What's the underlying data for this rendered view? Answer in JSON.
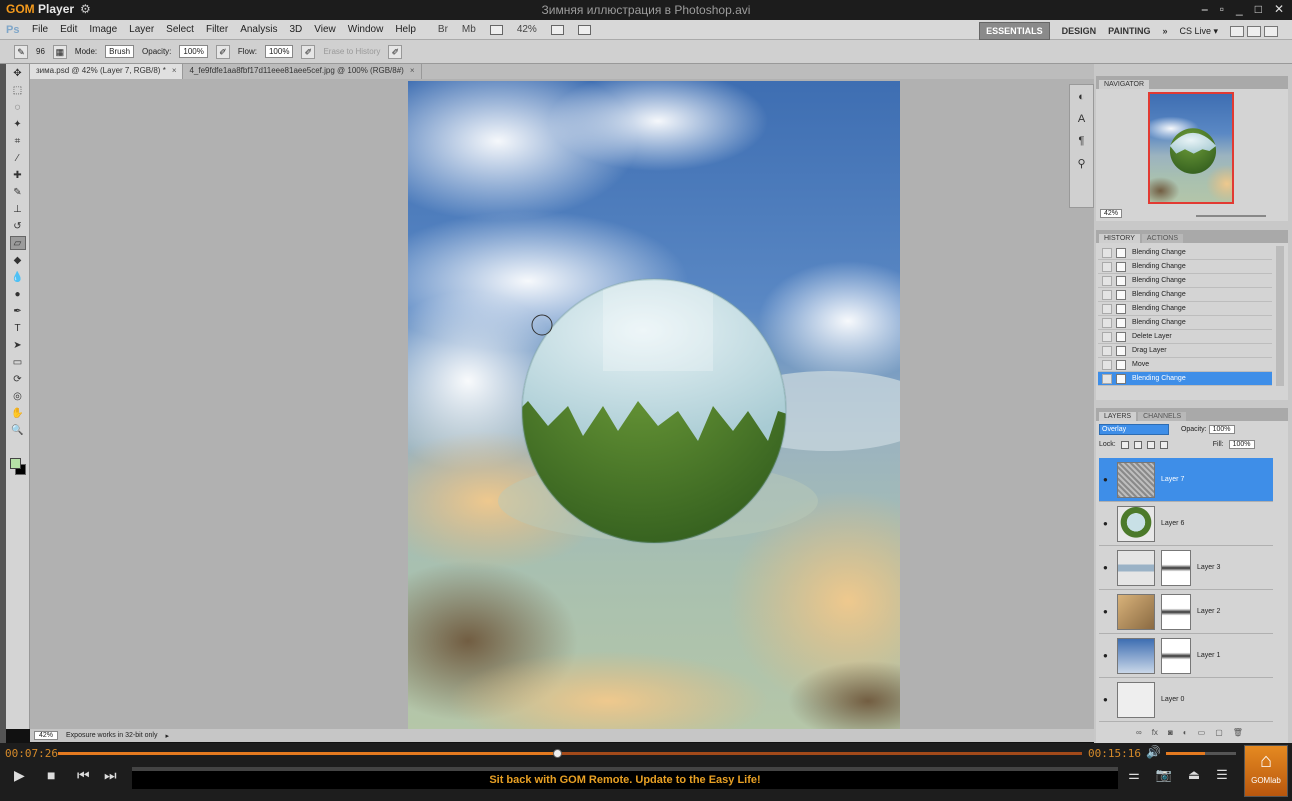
{
  "gom": {
    "logo_prefix": "GOM",
    "logo_suffix": "Player",
    "file_title": "Зимняя иллюстрация в Photoshop.avi",
    "time_current": "00:07:26",
    "time_total": "00:15:16",
    "progress": 0.487,
    "volume": 0.55,
    "marquee": "Sit back with GOM Remote. Update to the Easy Life!",
    "gomlab_label": "GOMlab"
  },
  "ps": {
    "logo": "Ps",
    "menu": [
      "File",
      "Edit",
      "Image",
      "Layer",
      "Select",
      "Filter",
      "Analysis",
      "3D",
      "View",
      "Window",
      "Help"
    ],
    "app_icons": [
      "Br",
      "Mb"
    ],
    "zoom": "42%",
    "workspaces": [
      "ESSENTIALS",
      "DESIGN",
      "PAINTING",
      "»"
    ],
    "cs_live": "CS Live ▾",
    "options": {
      "brush_size": "96",
      "mode_label": "Mode:",
      "mode_value": "Brush",
      "opacity_label": "Opacity:",
      "opacity_value": "100%",
      "flow_label": "Flow:",
      "flow_value": "100%",
      "erase_to_history": "Erase to History"
    },
    "tabs": [
      {
        "label": "зима.psd @ 42% (Layer 7, RGB/8) *"
      },
      {
        "label": "4_fe9fdfe1aa8fbf17d11eee81aee5cef.jpg @ 100% (RGB/8#)"
      }
    ],
    "status": {
      "zoom": "42%",
      "message": "Exposure works in 32-bit only"
    },
    "navigator": {
      "title": "NAVIGATOR",
      "zoom": "42%"
    },
    "history": {
      "tabs": [
        "HISTORY",
        "ACTIONS"
      ],
      "items": [
        "Blending Change",
        "Blending Change",
        "Blending Change",
        "Blending Change",
        "Blending Change",
        "Blending Change",
        "Delete Layer",
        "Drag Layer",
        "Move",
        "Blending Change"
      ]
    },
    "layers": {
      "tabs": [
        "LAYERS",
        "CHANNELS"
      ],
      "blend_mode": "Overlay",
      "opacity_label": "Opacity:",
      "opacity_value": "100%",
      "lock_label": "Lock:",
      "fill_label": "Fill:",
      "fill_value": "100%",
      "items": [
        "Layer 7",
        "Layer 6",
        "Layer 3",
        "Layer 2",
        "Layer 1",
        "Layer 0"
      ]
    }
  }
}
